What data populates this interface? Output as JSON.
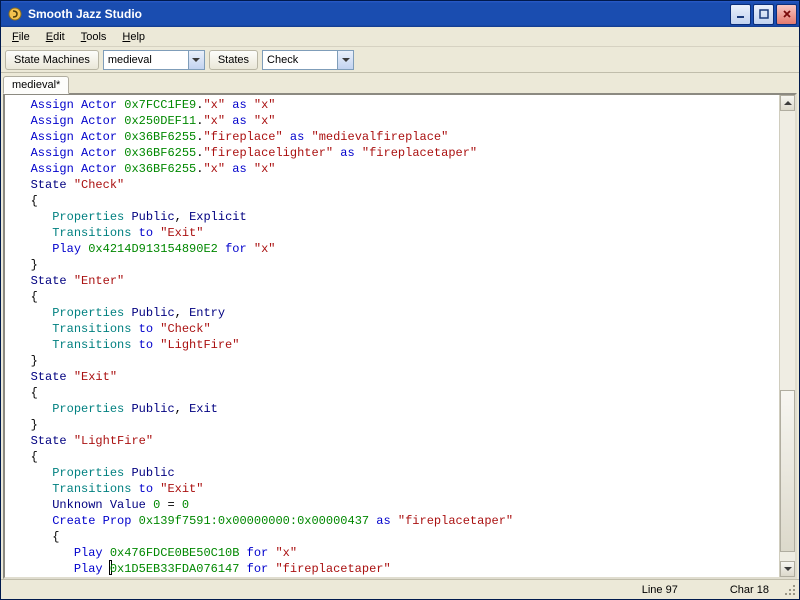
{
  "title": "Smooth Jazz Studio",
  "menu": {
    "file": "File",
    "edit": "Edit",
    "tools": "Tools",
    "help": "Help"
  },
  "toolbar": {
    "state_machines_btn": "State Machines",
    "machine_combo": "medieval",
    "states_btn": "States",
    "state_combo": "Check"
  },
  "tab": {
    "label": "medieval*"
  },
  "status": {
    "line_label": "Line",
    "line_value": "97",
    "char_label": "Char",
    "char_value": "18"
  },
  "code": {
    "kw": {
      "assign": "Assign",
      "actor": "Actor",
      "as": "as",
      "state": "State",
      "properties": "Properties",
      "transitions": "Transitions",
      "to": "to",
      "play": "Play",
      "for": "for",
      "unknown": "Unknown",
      "value": "Value",
      "create": "Create",
      "prop": "Prop",
      "public": "Public",
      "explicit": "Explicit",
      "entry": "Entry",
      "exit": "Exit"
    },
    "hex": {
      "a1": "0x7FCC1FE9",
      "a2": "0x250DEF11",
      "a3": "0x36BF6255",
      "play1": "0x4214D913154890E2",
      "propid": "0x139f7591:0x00000000:0x00000437",
      "play2": "0x476FDCE0BE50C10B",
      "play3": "0x1D5EB33FDA076147"
    },
    "str": {
      "x": "\"x\"",
      "fireplace": "\"fireplace\"",
      "medievalfireplace": "\"medievalfireplace\"",
      "fireplacelighter": "\"fireplacelighter\"",
      "fireplacetaper": "\"fireplacetaper\"",
      "check": "\"Check\"",
      "enter": "\"Enter\"",
      "exit": "\"Exit\"",
      "lightfire": "\"LightFire\""
    },
    "num": {
      "zero": "0"
    }
  }
}
